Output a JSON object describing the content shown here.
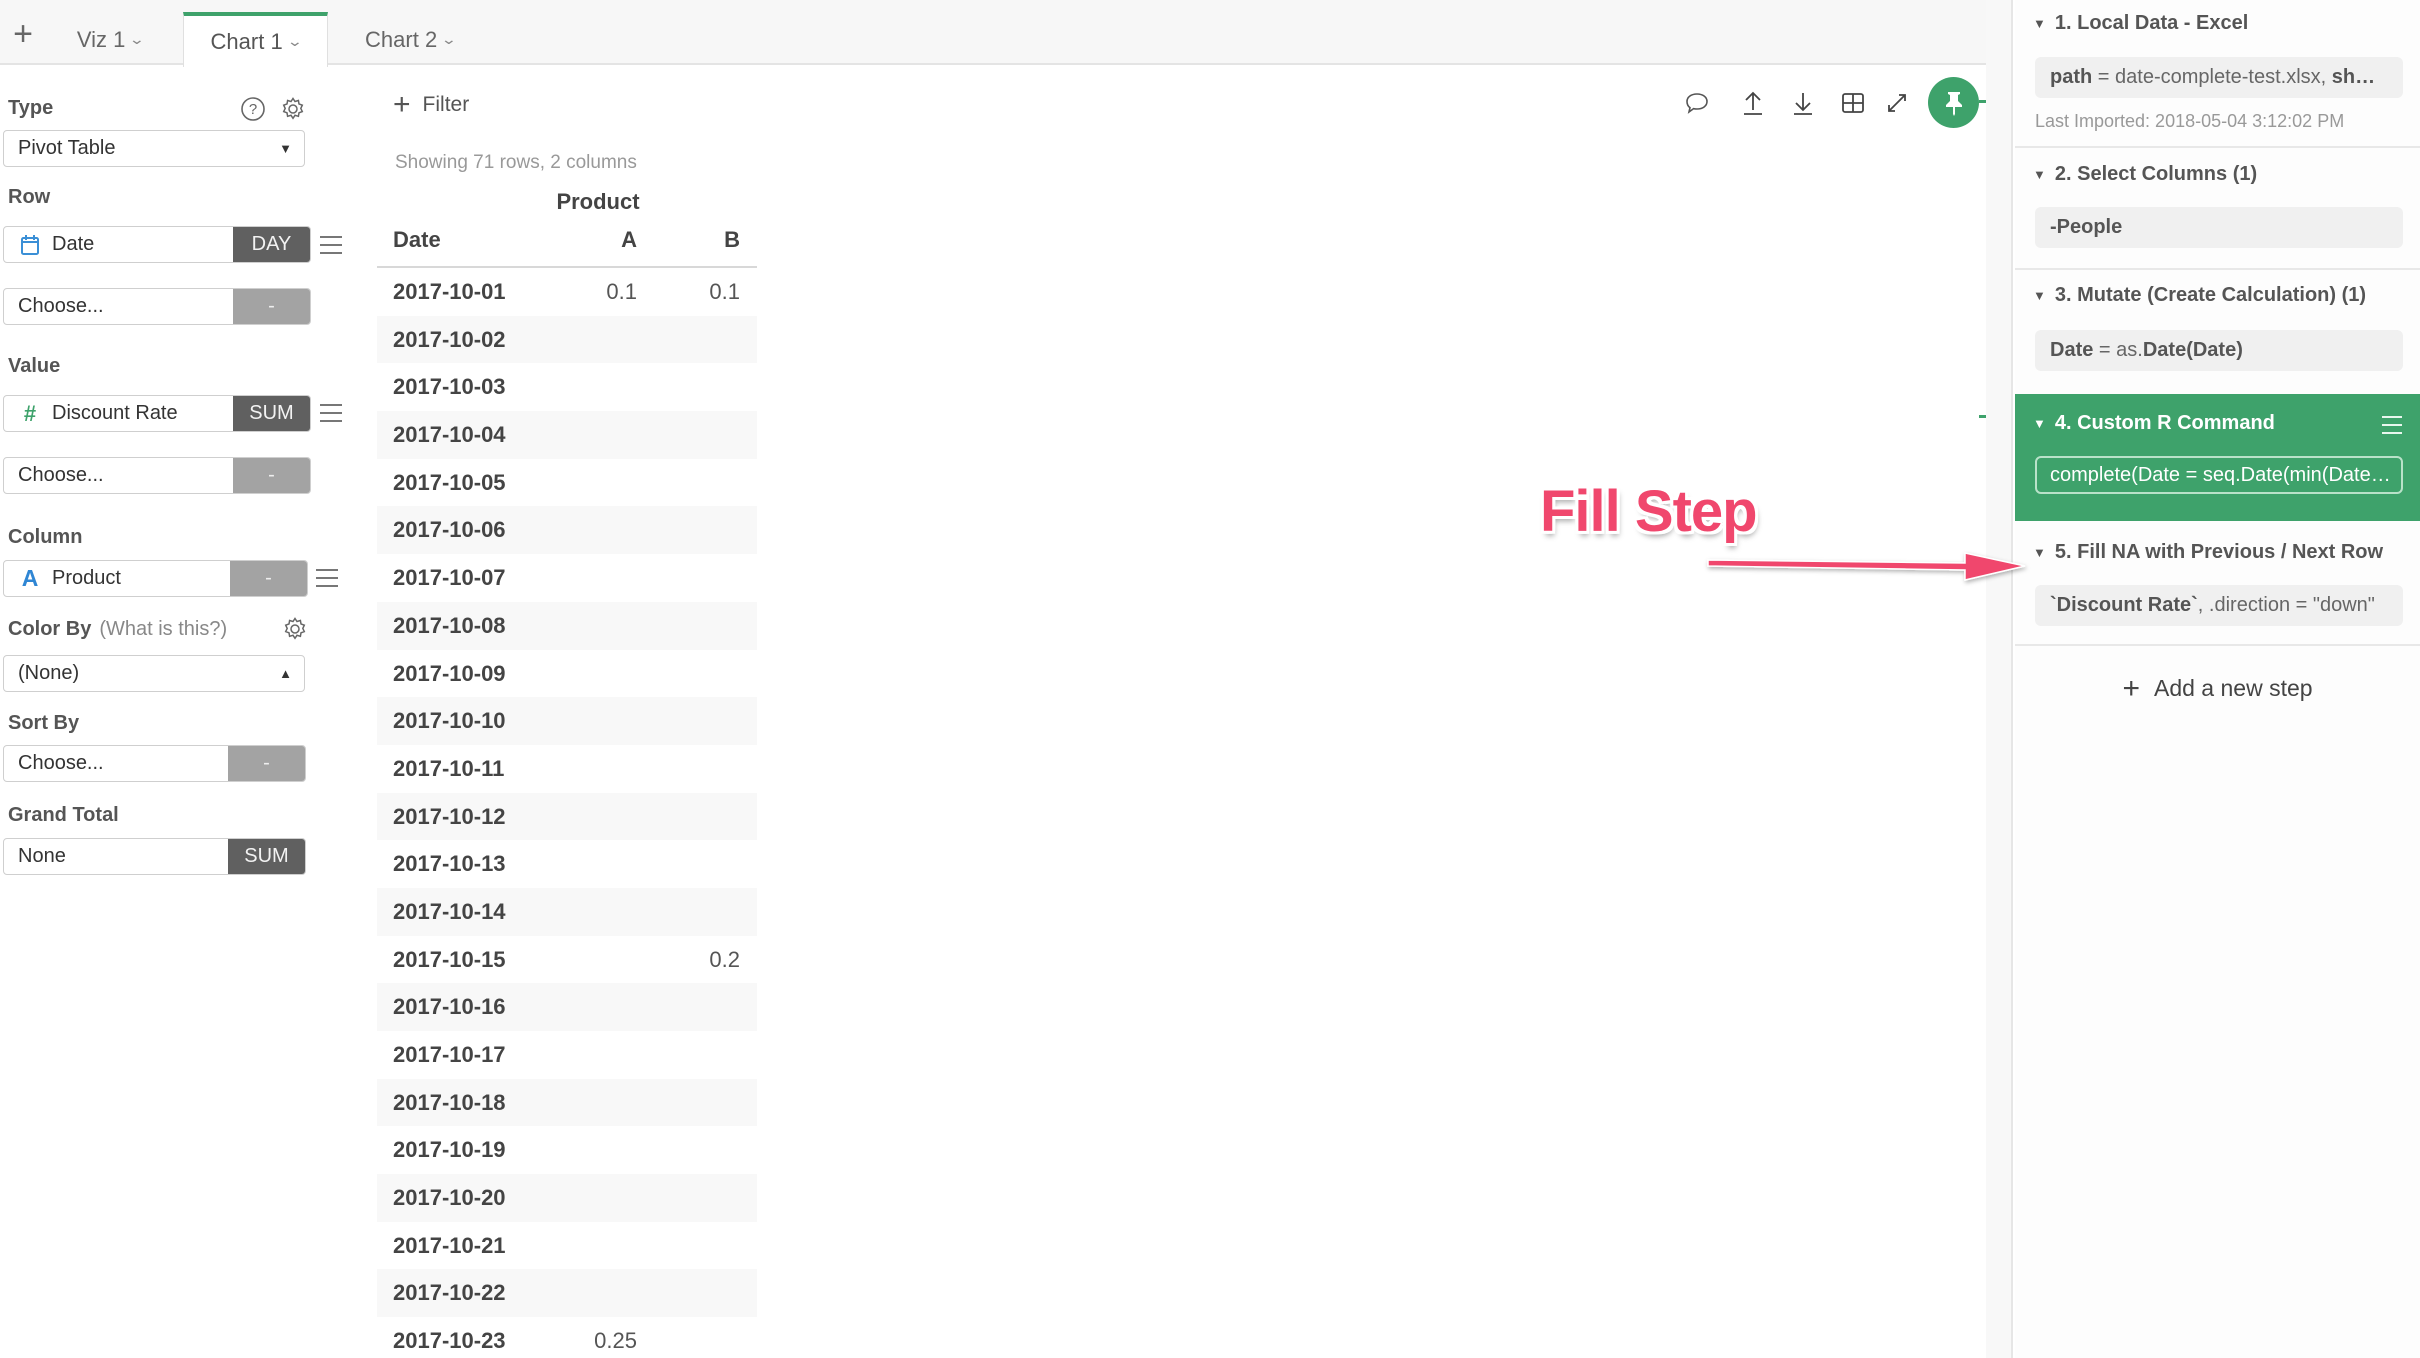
{
  "tabs": {
    "add_label": "+",
    "items": [
      {
        "label": "Viz 1",
        "active": false
      },
      {
        "label": "Chart 1",
        "active": true
      },
      {
        "label": "Chart 2",
        "active": false
      }
    ]
  },
  "config": {
    "type": {
      "label": "Type",
      "value": "Pivot Table"
    },
    "row": {
      "label": "Row",
      "field": {
        "name": "Date",
        "icon": "calendar-icon",
        "aggregation": "DAY"
      },
      "choose": {
        "placeholder": "Choose...",
        "aggregation": "-"
      }
    },
    "value": {
      "label": "Value",
      "field": {
        "name": "Discount Rate",
        "icon": "hash-icon",
        "icon_glyph": "#",
        "aggregation": "SUM"
      },
      "choose": {
        "placeholder": "Choose...",
        "aggregation": "-"
      }
    },
    "column": {
      "label": "Column",
      "field": {
        "name": "Product",
        "icon": "text-type-icon",
        "icon_glyph": "A",
        "aggregation": "-"
      }
    },
    "color_by": {
      "label": "Color By",
      "hint": "(What is this?)",
      "value": "(None)"
    },
    "sort_by": {
      "label": "Sort By",
      "placeholder": "Choose...",
      "aggregation": "-"
    },
    "grand_total": {
      "label": "Grand Total",
      "value": "None",
      "aggregation": "SUM"
    }
  },
  "main": {
    "filter_label": "Filter",
    "row_info": "Showing 71 rows, 2 columns",
    "toolbar": [
      "comment-icon",
      "upload-icon",
      "download-icon",
      "table-icon",
      "expand-icon",
      "pin-icon"
    ]
  },
  "pivot": {
    "column_group": "Product",
    "headers": {
      "row": "Date",
      "a": "A",
      "b": "B"
    },
    "rows": [
      {
        "date": "2017-10-01",
        "a": "0.1",
        "b": "0.1"
      },
      {
        "date": "2017-10-02",
        "a": "",
        "b": ""
      },
      {
        "date": "2017-10-03",
        "a": "",
        "b": ""
      },
      {
        "date": "2017-10-04",
        "a": "",
        "b": ""
      },
      {
        "date": "2017-10-05",
        "a": "",
        "b": ""
      },
      {
        "date": "2017-10-06",
        "a": "",
        "b": ""
      },
      {
        "date": "2017-10-07",
        "a": "",
        "b": ""
      },
      {
        "date": "2017-10-08",
        "a": "",
        "b": ""
      },
      {
        "date": "2017-10-09",
        "a": "",
        "b": ""
      },
      {
        "date": "2017-10-10",
        "a": "",
        "b": ""
      },
      {
        "date": "2017-10-11",
        "a": "",
        "b": ""
      },
      {
        "date": "2017-10-12",
        "a": "",
        "b": ""
      },
      {
        "date": "2017-10-13",
        "a": "",
        "b": ""
      },
      {
        "date": "2017-10-14",
        "a": "",
        "b": ""
      },
      {
        "date": "2017-10-15",
        "a": "",
        "b": "0.2"
      },
      {
        "date": "2017-10-16",
        "a": "",
        "b": ""
      },
      {
        "date": "2017-10-17",
        "a": "",
        "b": ""
      },
      {
        "date": "2017-10-18",
        "a": "",
        "b": ""
      },
      {
        "date": "2017-10-19",
        "a": "",
        "b": ""
      },
      {
        "date": "2017-10-20",
        "a": "",
        "b": ""
      },
      {
        "date": "2017-10-21",
        "a": "",
        "b": ""
      },
      {
        "date": "2017-10-22",
        "a": "",
        "b": ""
      },
      {
        "date": "2017-10-23",
        "a": "0.25",
        "b": ""
      }
    ]
  },
  "steps": {
    "items": [
      {
        "title": "1. Local Data - Excel",
        "detail_key": "path",
        "detail_rest": " = date-complete-test.xlsx, ",
        "detail_key2": "sh…",
        "meta": "Last Imported: 2018-05-04 3:12:02 PM"
      },
      {
        "title": "2. Select Columns (1)",
        "detail_bold": "-People"
      },
      {
        "title": "3. Mutate (Create Calculation) (1)",
        "detail_key": "Date",
        "detail_mid": " = as.",
        "detail_key2": "Date(Date)"
      },
      {
        "title": "4. Custom R Command",
        "detail": "complete(Date = seq.Date(min(Date…",
        "active": true
      },
      {
        "title": "5. Fill NA with Previous / Next Row",
        "detail_key": "`Discount Rate`",
        "detail_rest": ", .direction = \"down\""
      }
    ],
    "add_label": "Add a new step"
  },
  "annotation": {
    "text": "Fill Step",
    "color": "#f0476d"
  },
  "colors": {
    "accent": "#3ea26b",
    "annotation": "#f0476d",
    "date_icon": "#3a8fd6",
    "number_icon": "#3ea26b",
    "text_icon": "#2f86d4"
  }
}
